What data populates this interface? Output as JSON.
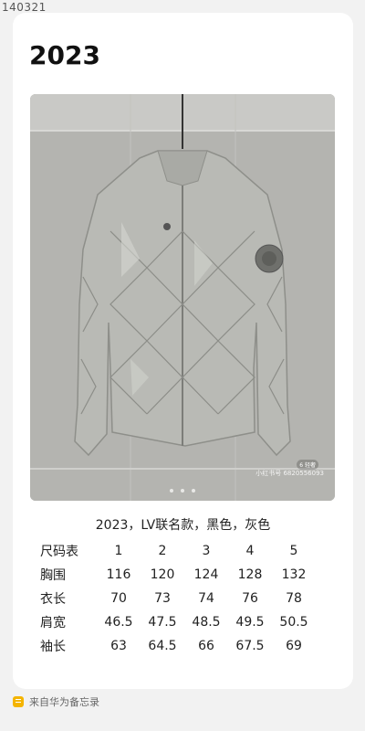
{
  "top_id": "140321",
  "note": {
    "title": "2023",
    "caption": "2023，LV联名款，黑色，灰色",
    "image_watermark": "小红书号 6820556093",
    "image_badge": "6 轻奢",
    "size_table": {
      "headers": [
        "尺码表",
        "1",
        "2",
        "3",
        "4",
        "5"
      ],
      "rows": [
        {
          "label": "胸围",
          "values": [
            "116",
            "120",
            "124",
            "128",
            "132"
          ]
        },
        {
          "label": "衣长",
          "values": [
            "70",
            "73",
            "74",
            "76",
            "78"
          ]
        },
        {
          "label": "肩宽",
          "values": [
            "46.5",
            "47.5",
            "48.5",
            "49.5",
            "50.5"
          ]
        },
        {
          "label": "袖长",
          "values": [
            "63",
            "64.5",
            "66",
            "67.5",
            "69"
          ]
        }
      ]
    }
  },
  "footer": {
    "text": "来自华为备忘录",
    "icon": "memo-icon"
  },
  "colors": {
    "background": "#f2f2f2",
    "card": "#ffffff",
    "jacket": "#b9bab5"
  }
}
